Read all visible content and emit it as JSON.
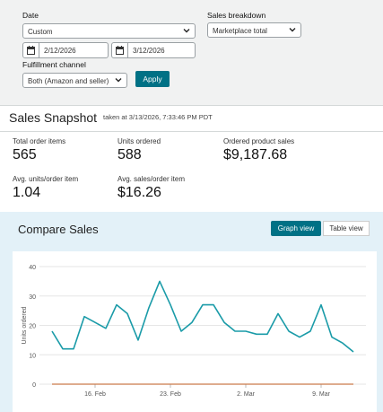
{
  "filters": {
    "date_label": "Date",
    "date_value": "Custom",
    "start_date": "2/12/2026",
    "end_date": "3/12/2026",
    "fulfillment_label": "Fulfillment channel",
    "fulfillment_value": "Both (Amazon and seller)",
    "breakdown_label": "Sales breakdown",
    "breakdown_value": "Marketplace total",
    "apply_label": "Apply"
  },
  "snapshot": {
    "title": "Sales Snapshot",
    "taken_at": "taken at 3/13/2026, 7:33:46 PM PDT",
    "metrics": [
      {
        "label": "Total order items",
        "value": "565"
      },
      {
        "label": "Units ordered",
        "value": "588"
      },
      {
        "label": "Ordered product sales",
        "value": "$9,187.68"
      },
      {
        "label": "Avg. units/order item",
        "value": "1.04"
      },
      {
        "label": "Avg. sales/order item",
        "value": "$16.26"
      }
    ]
  },
  "compare": {
    "title": "Compare Sales",
    "graph_view_label": "Graph view",
    "table_view_label": "Table view"
  },
  "colors": {
    "accent": "#007185",
    "series_line": "#1a9ba8",
    "baseline": "#c97a4a"
  },
  "chart_data": {
    "type": "line",
    "ylabel": "Units ordered",
    "ylim": [
      0,
      40
    ],
    "yticks": [
      0,
      10,
      20,
      30,
      40
    ],
    "x_tick_labels": [
      {
        "label": "16. Feb",
        "index": 4
      },
      {
        "label": "23. Feb",
        "index": 11
      },
      {
        "label": "2. Mar",
        "index": 18
      },
      {
        "label": "9. Mar",
        "index": 25
      }
    ],
    "series": [
      {
        "values": [
          18,
          12,
          12,
          23,
          21,
          19,
          27,
          24,
          15,
          26,
          35,
          27,
          18,
          21,
          27,
          27,
          21,
          18,
          18,
          17,
          17,
          24,
          18,
          16,
          18,
          27,
          16,
          14,
          11
        ]
      },
      {
        "values": [
          0,
          0,
          0,
          0,
          0,
          0,
          0,
          0,
          0,
          0,
          0,
          0,
          0,
          0,
          0,
          0,
          0,
          0,
          0,
          0,
          0,
          0,
          0,
          0,
          0,
          0,
          0,
          0,
          0
        ]
      }
    ]
  }
}
